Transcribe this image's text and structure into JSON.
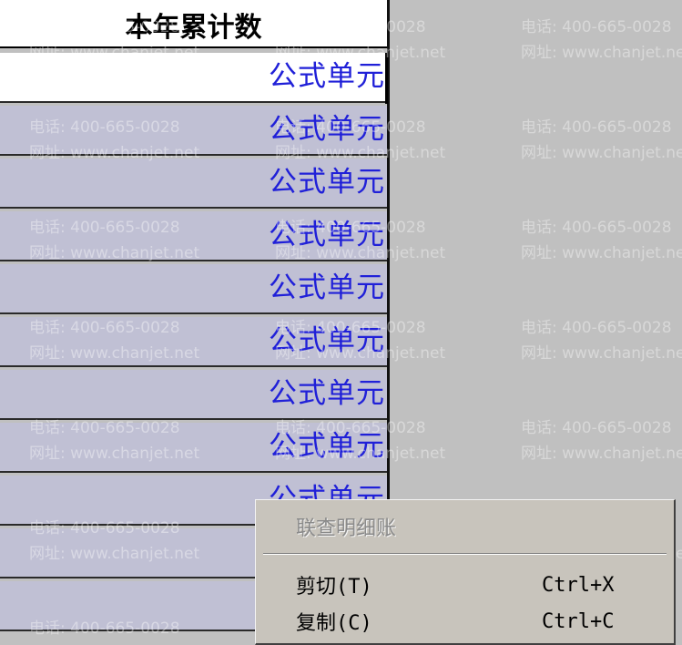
{
  "sheet": {
    "header": "本年累计数",
    "rows": [
      "公式单元",
      "公式单元",
      "公式单元",
      "公式单元",
      "公式单元",
      "公式单元",
      "公式单元",
      "公式单元",
      "公式单元",
      "",
      ""
    ]
  },
  "watermark": {
    "phone": "电话: 400-665-0028",
    "site": "网址: www.chanjet.net"
  },
  "context_menu": {
    "items": [
      {
        "label": "联查明细账",
        "shortcut": "",
        "enabled": false
      },
      {
        "label": "剪切(T)",
        "shortcut": "Ctrl+X",
        "enabled": true
      },
      {
        "label": "复制(C)",
        "shortcut": "Ctrl+C",
        "enabled": true
      }
    ]
  },
  "colors": {
    "formula_text": "#2020d8",
    "row_bg": "#c0c0d4",
    "selected_bg": "#ffffff",
    "menu_bg": "#c8c4bc",
    "outside_bg": "#c0c0c0"
  }
}
